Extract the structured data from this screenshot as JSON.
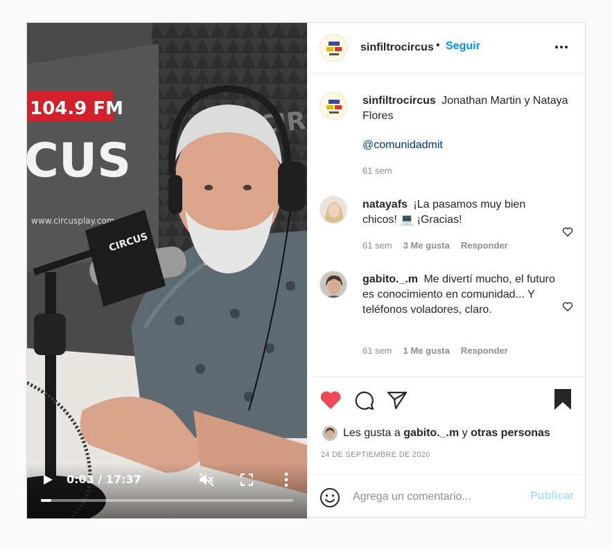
{
  "video": {
    "time_current": "0:03",
    "time_total": "17:37",
    "time_display": "0:03 / 17:37",
    "progress_fraction": 0.003,
    "muted": true,
    "signage_frequency": "104.9 FM",
    "signage_brand": "CUS",
    "signage_url": "www.circusplay.com",
    "mic_flag": "CIRCUS"
  },
  "header": {
    "username": "sinfiltrocircus",
    "separator": "•",
    "follow_label": "Seguir"
  },
  "caption": {
    "username": "sinfiltrocircus",
    "text": "Jonathan Martin y Nataya Flores",
    "mention": "@comunidadmit",
    "time": "61 sem"
  },
  "comments": [
    {
      "username": "natayafs",
      "text": "¡La pasamos muy bien chicos! 💻 ¡Gracias!",
      "time": "61 sem",
      "likes": "3 Me gusta",
      "reply_label": "Responder"
    },
    {
      "username": "gabito._.m",
      "text": "Me divertí mucho, el futuro es conocimiento en comunidad... Y teléfonos voladores, claro.",
      "time": "61 sem",
      "likes": "1 Me gusta",
      "reply_label": "Responder"
    }
  ],
  "likes_line": {
    "prefix": "Les gusta a",
    "user": "gabito._.m",
    "connector": "y",
    "others": "otras personas"
  },
  "date": "24 DE SEPTIEMBRE DE 2020",
  "add_comment": {
    "placeholder": "Agrega un comentario...",
    "publish_label": "Publicar"
  },
  "colors": {
    "accent": "#0095f6",
    "like_red": "#ed4956",
    "publish_disabled": "#b2dffc",
    "muted_text": "#8e8e8e",
    "mention": "#00376b"
  }
}
